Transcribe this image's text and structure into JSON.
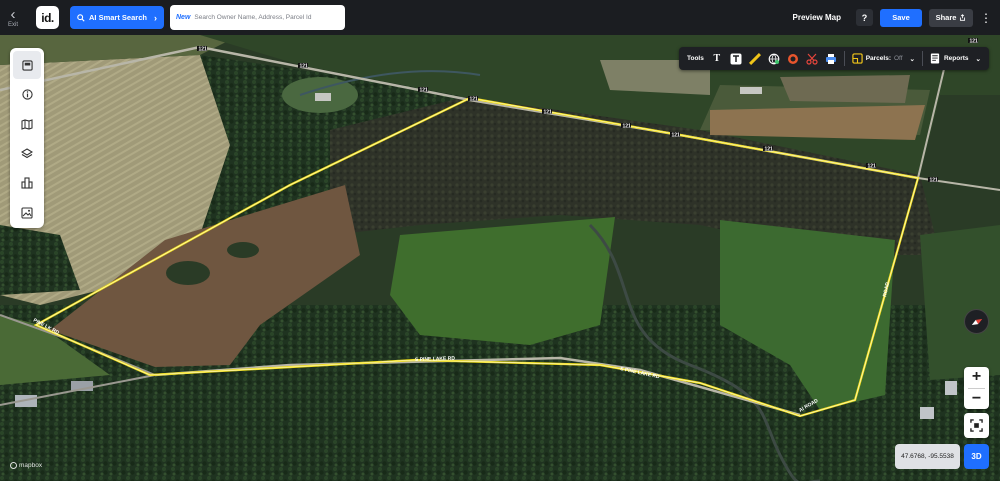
{
  "topbar": {
    "exit_label": "Exit",
    "logo_text": "id.",
    "ai_search_label": "AI Smart Search",
    "search_new_badge": "New",
    "search_placeholder": "Search Owner Name, Address, Parcel Id",
    "preview_map_label": "Preview Map",
    "help_label": "?",
    "save_label": "Save",
    "share_label": "Share"
  },
  "left_rail": {
    "items": [
      {
        "name": "layers-panel-icon"
      },
      {
        "name": "info-icon"
      },
      {
        "name": "map-icon"
      },
      {
        "name": "stack-layers-icon"
      },
      {
        "name": "buildings-icon"
      },
      {
        "name": "image-icon"
      }
    ]
  },
  "toolbar": {
    "tools_label": "Tools",
    "parcels_label": "Parcels:",
    "parcels_state": "Off",
    "reports_label": "Reports"
  },
  "map": {
    "road_labels": [
      "121",
      "121",
      "121",
      "121",
      "121",
      "121",
      "121",
      "121",
      "121",
      "121",
      "121",
      "S PINE LAKE RD",
      "S PINE LAKE RD",
      "PINE LK RD",
      "Al ROAD",
      "ROAD"
    ],
    "coordinates": "47.6768, -95.5538",
    "mode_3d_label": "3D",
    "attribution": "mapbox"
  },
  "colors": {
    "accent": "#1f6fff",
    "parcel_outline": "#f2e01c",
    "topbar_bg": "#1b1d21"
  }
}
